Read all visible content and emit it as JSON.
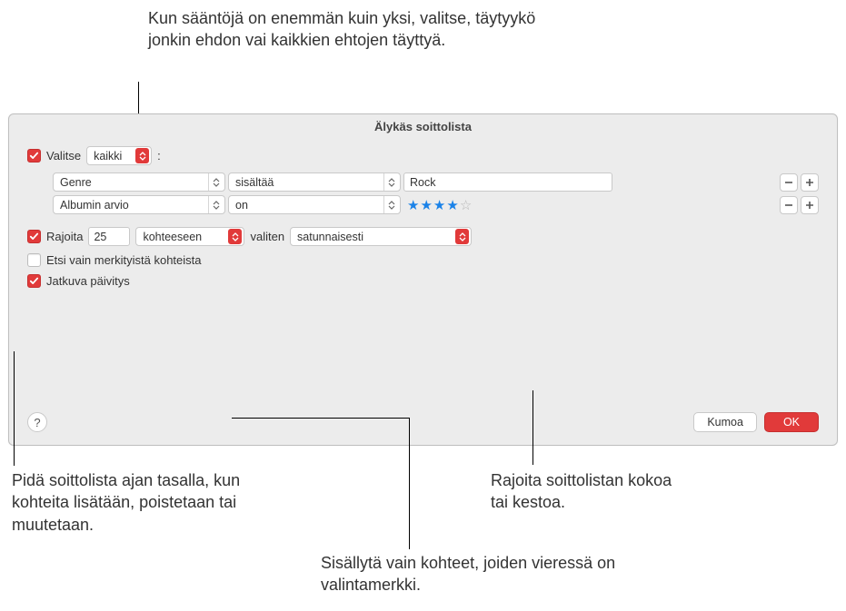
{
  "annotations": {
    "top": "Kun sääntöjä on enemmän kuin yksi, valitse, täytyykö jonkin ehdon vai kaikkien ehtojen täyttyä.",
    "bottom_left": "Pidä soittolista ajan tasalla, kun kohteita lisätään, poistetaan tai muutetaan.",
    "bottom_right": "Rajoita soittolistan kokoa tai kestoa.",
    "bottom_mid": "Sisällytä vain kohteet, joiden vieressä on valintamerkki."
  },
  "dialog": {
    "title": "Älykäs soittolista",
    "match": {
      "label": "Valitse",
      "mode": "kaikki",
      "suffix": ":"
    },
    "rules": [
      {
        "field": "Genre",
        "op": "sisältää",
        "value_type": "text",
        "value": "Rock"
      },
      {
        "field": "Albumin arvio",
        "op": "on",
        "value_type": "stars",
        "stars_filled": 4,
        "stars_total": 5
      }
    ],
    "limit": {
      "label": "Rajoita",
      "count": "25",
      "unit": "kohteeseen",
      "by_label": "valiten",
      "by_value": "satunnaisesti"
    },
    "checked_only_label": "Etsi vain merkityistä kohteista",
    "live_update_label": "Jatkuva päivitys",
    "buttons": {
      "cancel": "Kumoa",
      "ok": "OK"
    },
    "help_glyph": "?"
  }
}
